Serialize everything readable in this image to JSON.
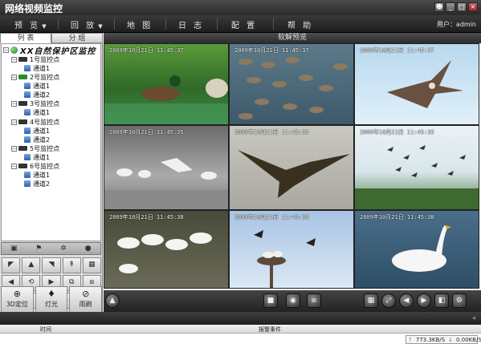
{
  "app": {
    "title": "网络视频监控",
    "window_buttons": [
      "user-icon",
      "minimize-icon",
      "maximize-icon",
      "close-icon"
    ]
  },
  "menu": {
    "items": [
      {
        "label": "预 览",
        "caret": "▼"
      },
      {
        "label": "回 放",
        "caret": "▼"
      },
      {
        "label": "地 图"
      },
      {
        "label": "日 志"
      },
      {
        "label": "配 置"
      },
      {
        "label": "帮 助"
      }
    ],
    "user": "用户：admin"
  },
  "left": {
    "tabs": [
      "列 表",
      "分 组"
    ],
    "tree": {
      "root": "XX自然保护区监控",
      "groups": [
        {
          "label": "1号监控点",
          "channels": [
            "通道1"
          ]
        },
        {
          "label": "2号监控点",
          "channels": [
            "通道1",
            "通道2"
          ]
        },
        {
          "label": "3号监控点",
          "channels": [
            "通道1"
          ]
        },
        {
          "label": "4号监控点",
          "channels": [
            "通道1",
            "通道2"
          ]
        },
        {
          "label": "5号监控点",
          "channels": [
            "通道1"
          ]
        },
        {
          "label": "6号监控点",
          "channels": [
            "通道1",
            "通道2"
          ]
        }
      ]
    },
    "bottom_buttons": [
      {
        "label": "3D定位",
        "icon": "zoom-icon"
      },
      {
        "label": "灯光",
        "icon": "light-icon"
      },
      {
        "label": "雨刷",
        "icon": "wiper-icon"
      }
    ]
  },
  "main": {
    "header": "软解预览",
    "tiles": [
      "2009年10月21日 11:45:37",
      "2009年10月21日 11:45:37",
      "2009年10月21日 11:45:37",
      "2009年10月21日 11:45:35",
      "2009年10月21日 11:45:35",
      "2009年10月21日 11:45:35",
      "2009年10月21日 11:45:38",
      "2009年10月21日 11:45:38",
      "2009年10月21日 11:45:38"
    ]
  },
  "alarm": {
    "col_time": "时间",
    "col_event": "报警事件",
    "up_rate": "773.3KB/S",
    "down_rate": "0.00KB/S"
  }
}
